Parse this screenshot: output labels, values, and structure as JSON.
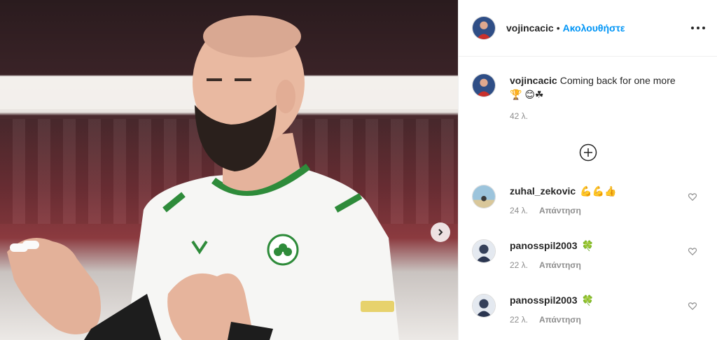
{
  "post": {
    "author": "vojincacic",
    "separator": "•",
    "follow_label": "Ακολουθήστε",
    "caption_user": "vojincacic",
    "caption_text": "Coming back for one more",
    "caption_emojis": "🏆 😊☘",
    "caption_time": "42 λ."
  },
  "comments": [
    {
      "user": "zuhal_zekovic",
      "text": "💪💪👍",
      "time": "24 λ.",
      "reply_label": "Απάντηση"
    },
    {
      "user": "panosspil2003",
      "text": "🍀",
      "time": "22 λ.",
      "reply_label": "Απάντηση"
    },
    {
      "user": "panosspil2003",
      "text": "🍀",
      "time": "22 λ.",
      "reply_label": "Απάντηση"
    }
  ],
  "colors": {
    "accent": "#0095f6",
    "text": "#262626",
    "muted": "#8e8e8e",
    "jersey_green": "#2e8b3a"
  },
  "icons": [
    "chevron-right-icon",
    "more-options-icon",
    "load-more-comments-icon",
    "heart-icon"
  ]
}
